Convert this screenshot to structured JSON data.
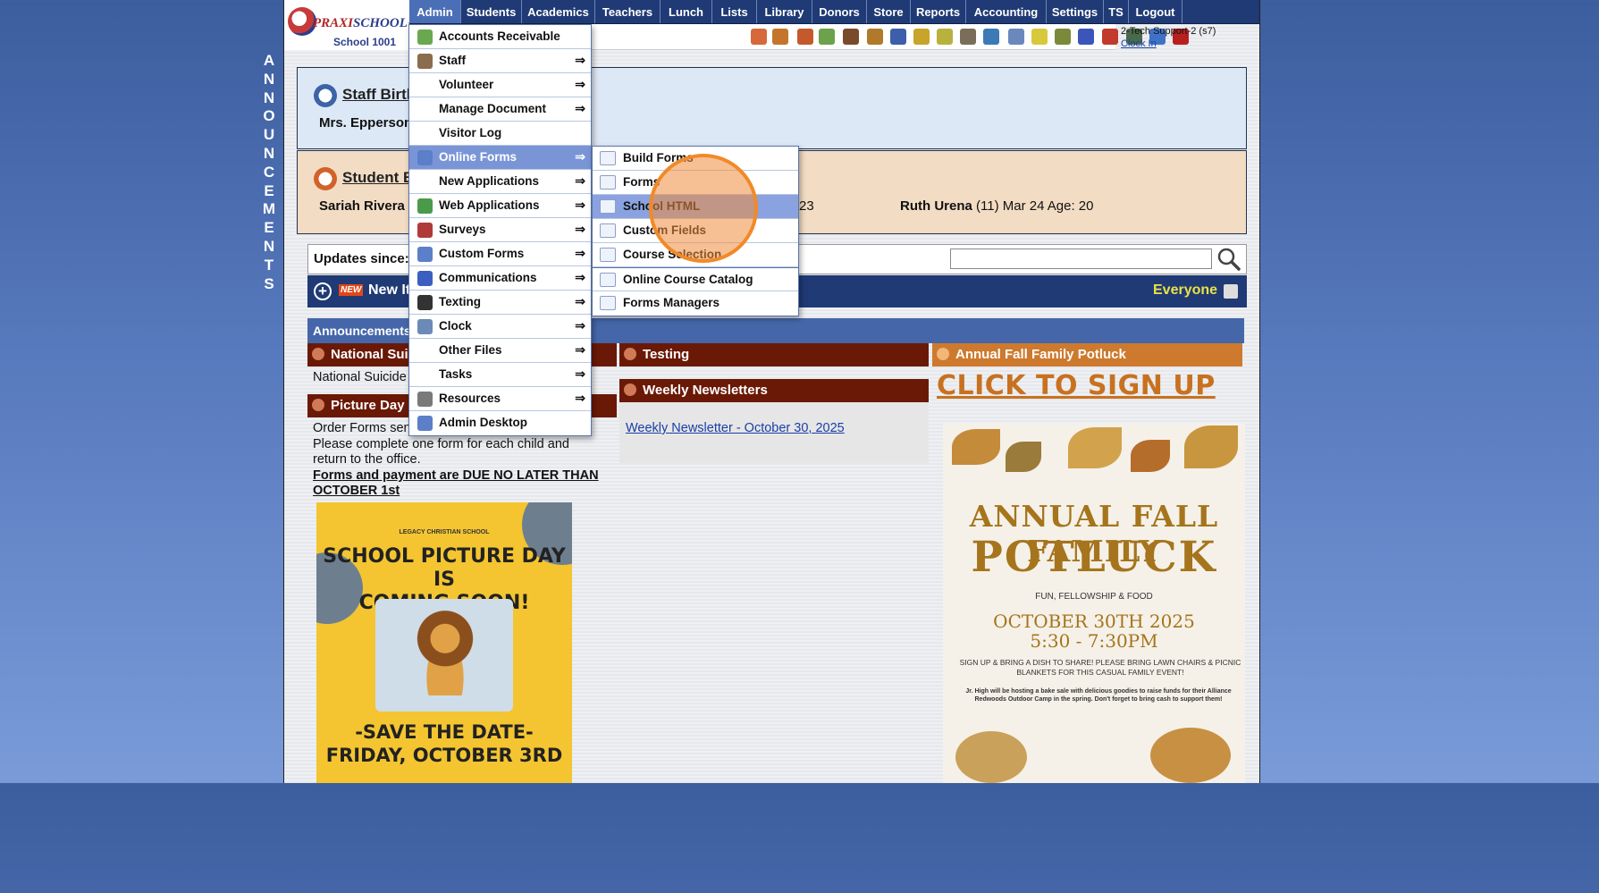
{
  "announcements_vertical": [
    "A",
    "N",
    "N",
    "O",
    "U",
    "N",
    "C",
    "E",
    "M",
    "E",
    "N",
    "T",
    "S"
  ],
  "logo": {
    "brand_left": "PRAXI",
    "brand_right": "SCHOOL",
    "tm": "™",
    "school": "School 1001"
  },
  "topnav": [
    "Admin",
    "Students",
    "Academics",
    "Teachers",
    "Lunch",
    "Lists",
    "Library",
    "Donors",
    "Store",
    "Reports",
    "Accounting",
    "Settings",
    "TS",
    "Logout"
  ],
  "topnav_active": "Admin",
  "user": {
    "name": "2-Tech Support-2 (s7)",
    "clock_link": "Clock In"
  },
  "staff_birthday": {
    "title": "Staff Birthdays",
    "entry": "Mrs. Epperson"
  },
  "student_birthday": {
    "title": "Student Birthdays",
    "entry1": "Sariah Rivera",
    "entry2_age": "23",
    "entry3_name": "Ruth Urena",
    "entry3_detail": " (11) Mar 24 Age: 20"
  },
  "updates": {
    "label": "Updates since:",
    "search_value": ""
  },
  "newbar": {
    "badge": "NEW",
    "text": "New Items",
    "audience": "Everyone"
  },
  "announcements_header": "Announcements",
  "column1": {
    "item1_title": "National Suicide Prevention",
    "item1_body": "National Suicide",
    "item2_title": "Picture Day",
    "item2_body_line1": "Order Forms sent home in Friday Folders.",
    "item2_body_line2": "Please complete one form for each child and",
    "item2_body_line3": "return to the office.",
    "item2_body_bold": "Forms and payment are DUE NO LATER THAN OCTOBER 1st"
  },
  "poster_picture": {
    "school": "LEGACY CHRISTIAN SCHOOL",
    "headline_1": "SCHOOL PICTURE DAY IS",
    "headline_2": "COMING SOON!",
    "save_1": "-SAVE THE DATE-",
    "save_2": "FRIDAY, OCTOBER 3RD"
  },
  "column2": {
    "item1_title": "Testing",
    "item2_title": "Weekly Newsletters",
    "item2_link": "Weekly Newsletter - October 30, 2025"
  },
  "column3": {
    "item1_title": "Annual Fall Family Potluck",
    "signup": "CLICK TO SIGN UP"
  },
  "poster_potluck": {
    "line1": "ANNUAL FALL FAMILY",
    "line2": "POTLUCK",
    "line3": "FUN, FELLOWSHIP & FOOD",
    "date": "OCTOBER 30TH 2025",
    "time": "5:30 - 7:30PM",
    "note": "SIGN UP & BRING A DISH TO SHARE! PLEASE BRING LAWN CHAIRS & PICNIC BLANKETS FOR THIS CASUAL FAMILY EVENT!",
    "note2": "Jr. High will be hosting a bake sale with delicious goodies to raise funds for their Alliance Redwoods Outdoor Camp in the spring. Don't forget to bring cash to support them!"
  },
  "admin_menu": [
    {
      "label": "Accounts Receivable",
      "submenu": false
    },
    {
      "label": "Staff",
      "submenu": true
    },
    {
      "label": "Volunteer",
      "submenu": true
    },
    {
      "label": "Manage Document",
      "submenu": true
    },
    {
      "label": "Visitor Log",
      "submenu": false
    },
    {
      "label": "Online Forms",
      "submenu": true,
      "highlighted": true
    },
    {
      "label": "New Applications",
      "submenu": true
    },
    {
      "label": "Web Applications",
      "submenu": true
    },
    {
      "label": "Surveys",
      "submenu": true
    },
    {
      "label": "Custom Forms",
      "submenu": true
    },
    {
      "label": "Communications",
      "submenu": true
    },
    {
      "label": "Texting",
      "submenu": true
    },
    {
      "label": "Clock",
      "submenu": true
    },
    {
      "label": "Other Files",
      "submenu": true
    },
    {
      "label": "Tasks",
      "submenu": true
    },
    {
      "label": "Resources",
      "submenu": true
    },
    {
      "label": "Admin Desktop",
      "submenu": false
    }
  ],
  "online_forms_submenu": [
    {
      "label": "Build Forms"
    },
    {
      "label": "Forms"
    },
    {
      "label": "School HTML",
      "highlighted": true
    },
    {
      "label": "Custom Fields"
    },
    {
      "label": "Course Selection"
    },
    {
      "label": "Online Course Catalog"
    },
    {
      "label": "Forms Managers"
    }
  ],
  "arrow_glyph": "⇒",
  "colors": {
    "nav": "#1f3a75",
    "menu_highlight": "#7a95d6",
    "click_ring": "#f08a28",
    "maroon": "#6a1906",
    "orange": "#cd7a2e"
  }
}
